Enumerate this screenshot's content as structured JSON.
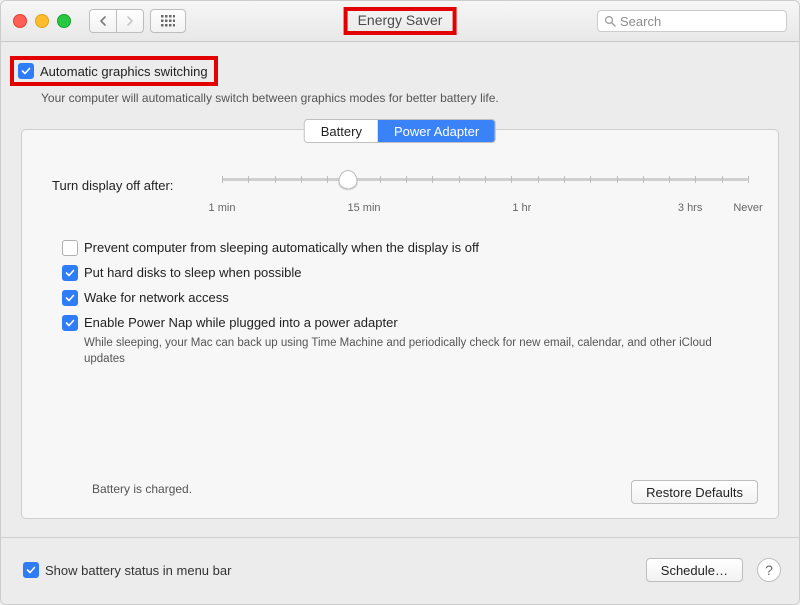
{
  "window": {
    "title": "Energy Saver"
  },
  "search": {
    "placeholder": "Search"
  },
  "auto_graphics": {
    "label": "Automatic graphics switching",
    "checked": true,
    "description": "Your computer will automatically switch between graphics modes for better battery life."
  },
  "tabs": {
    "battery": "Battery",
    "power_adapter": "Power Adapter",
    "active": "power_adapter"
  },
  "slider": {
    "label": "Turn display off after:",
    "ticks": {
      "t0": "1 min",
      "t1": "15 min",
      "t2": "1 hr",
      "t3": "3 hrs",
      "t4": "Never"
    },
    "value_percent": 24
  },
  "options": {
    "prevent_sleep": {
      "label": "Prevent computer from sleeping automatically when the display is off",
      "checked": false
    },
    "hdd_sleep": {
      "label": "Put hard disks to sleep when possible",
      "checked": true
    },
    "wake_network": {
      "label": "Wake for network access",
      "checked": true
    },
    "power_nap": {
      "label": "Enable Power Nap while plugged into a power adapter",
      "checked": true,
      "description": "While sleeping, your Mac can back up using Time Machine and periodically check for new email, calendar, and other iCloud updates"
    }
  },
  "status": {
    "battery": "Battery is charged."
  },
  "buttons": {
    "restore_defaults": "Restore Defaults",
    "schedule": "Schedule…"
  },
  "bottom": {
    "show_status": {
      "label": "Show battery status in menu bar",
      "checked": true
    }
  },
  "help": {
    "glyph": "?"
  }
}
